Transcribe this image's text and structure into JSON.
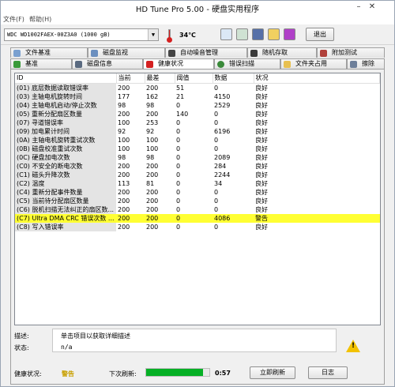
{
  "window": {
    "title": "HD Tune Pro 5.00 - 硬盘实用程序"
  },
  "menu": {
    "file": "文件(F)",
    "help": "帮助(H)"
  },
  "toolbar": {
    "drive": "WDC WD1002FAEX-00Z3A0 (1000 gB)",
    "temperature": "34℃",
    "exit_label": "退出"
  },
  "tabs_top": [
    "文件基准",
    "磁盘监视",
    "自动噪音管理",
    "随机存取",
    "附加测试"
  ],
  "tabs_bottom": [
    "基准",
    "磁盘信息",
    "健康状况",
    "错误扫描",
    "文件夹占用",
    "擦除"
  ],
  "table": {
    "headers": [
      "ID",
      "当前",
      "最差",
      "阈值",
      "数据",
      "状况"
    ],
    "rows": [
      [
        "(01) 底层数据读取错误率",
        "200",
        "200",
        "51",
        "0",
        "良好"
      ],
      [
        "(03) 主轴电机旋转时间",
        "177",
        "162",
        "21",
        "4150",
        "良好"
      ],
      [
        "(04) 主轴电机启动/停止次数",
        "98",
        "98",
        "0",
        "2529",
        "良好"
      ],
      [
        "(05) 重新分配扇区数量",
        "200",
        "200",
        "140",
        "0",
        "良好"
      ],
      [
        "(07) 寻道错误率",
        "100",
        "253",
        "0",
        "0",
        "良好"
      ],
      [
        "(09) 加电累计时间",
        "92",
        "92",
        "0",
        "6196",
        "良好"
      ],
      [
        "(0A) 主轴电机旋转重试次数",
        "100",
        "100",
        "0",
        "0",
        "良好"
      ],
      [
        "(0B) 磁盘校准重试次数",
        "100",
        "100",
        "0",
        "0",
        "良好"
      ],
      [
        "(0C) 硬盘加电次数",
        "98",
        "98",
        "0",
        "2089",
        "良好"
      ],
      [
        "(C0) 不安全的断电次数",
        "200",
        "200",
        "0",
        "284",
        "良好"
      ],
      [
        "(C1) 磁头升降次数",
        "200",
        "200",
        "0",
        "2244",
        "良好"
      ],
      [
        "(C2) 温度",
        "113",
        "81",
        "0",
        "34",
        "良好"
      ],
      [
        "(C4) 重新分配事件数量",
        "200",
        "200",
        "0",
        "0",
        "良好"
      ],
      [
        "(C5) 当前待分配扇区数量",
        "200",
        "200",
        "0",
        "0",
        "良好"
      ],
      [
        "(C6) 脱机扫描无法纠正的扇区数...",
        "200",
        "200",
        "0",
        "0",
        "良好"
      ],
      [
        "(C7) Ultra DMA CRC 错误次数 ...",
        "200",
        "200",
        "0",
        "4086",
        "警告"
      ],
      [
        "(C8) 写入错误率",
        "200",
        "200",
        "0",
        "0",
        "良好"
      ]
    ]
  },
  "details": {
    "desc_label": "描述:",
    "desc_text": "单击项目以获取详细描述",
    "status_label": "状态:",
    "status_text": "n/a"
  },
  "footer": {
    "health_label": "健康状况:",
    "health_value": "警告",
    "refresh_label": "下次刷新:",
    "refresh_progress": 0.9,
    "timer": "0:57",
    "refresh_now_label": "立即刷新",
    "log_label": "日志"
  },
  "colors": {
    "warning_row": "#ffff33",
    "health_warning": "#c8a000",
    "progress": "#06b025"
  }
}
